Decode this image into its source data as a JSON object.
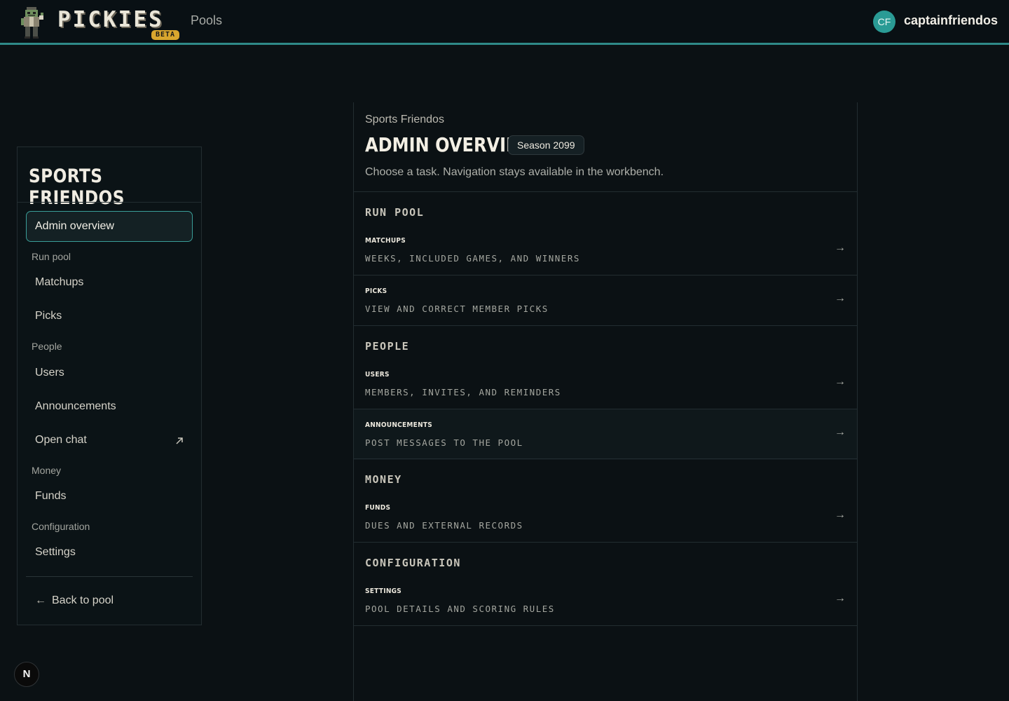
{
  "header": {
    "brand": "PICKIES",
    "badge": "BETA",
    "nav_pools": "Pools",
    "avatar_initials": "CF",
    "username": "captainfriendos"
  },
  "sidebar": {
    "title": "Sports Friendos",
    "active_item": "Admin overview",
    "groups": {
      "run_pool": "Run pool",
      "people": "People",
      "money": "Money",
      "configuration": "Configuration"
    },
    "items": {
      "matchups": "Matchups",
      "picks": "Picks",
      "users": "Users",
      "announcements": "Announcements",
      "open_chat": "Open chat",
      "funds": "Funds",
      "settings": "Settings"
    },
    "back_arrow": "←",
    "back_label": "Back to pool"
  },
  "main": {
    "crumb": "Sports Friendos",
    "title": "Admin Overview",
    "season": "Season 2099",
    "subtitle": "Choose a task. Navigation stays available in the workbench.",
    "arrow": "→",
    "sections": {
      "run_pool": "RUN POOL",
      "people": "PEOPLE",
      "money": "MONEY",
      "configuration": "CONFIGURATION"
    },
    "tasks": {
      "matchups": {
        "name": "MATCHUPS",
        "desc": "WEEKS, INCLUDED GAMES, AND WINNERS"
      },
      "picks": {
        "name": "PICKS",
        "desc": "VIEW AND CORRECT MEMBER PICKS"
      },
      "users": {
        "name": "USERS",
        "desc": "MEMBERS, INVITES, AND REMINDERS"
      },
      "announcements": {
        "name": "ANNOUNCEMENTS",
        "desc": "POST MESSAGES TO THE POOL"
      },
      "funds": {
        "name": "FUNDS",
        "desc": "DUES AND EXTERNAL RECORDS"
      },
      "settings": {
        "name": "SETTINGS",
        "desc": "POOL DETAILS AND SCORING RULES"
      }
    }
  },
  "dev_badge": "N",
  "colors": {
    "background": "#0b1114",
    "accent": "#2f8a88",
    "beta": "#d9a62e",
    "avatar": "#2a9b95"
  },
  "icons": {
    "logo": "pixel-zombie-mascot-icon",
    "open_chat": "external-link-arrow-icon",
    "task": "right-arrow-icon"
  }
}
